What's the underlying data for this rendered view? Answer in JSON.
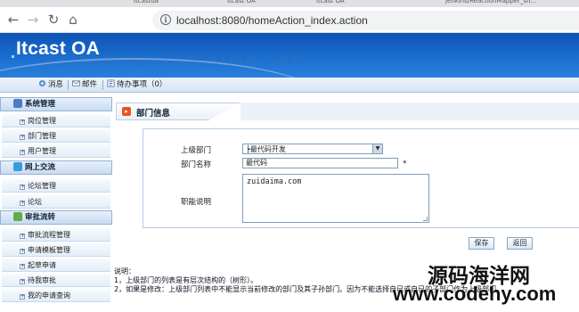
{
  "browser": {
    "tabs": [
      "",
      "Itcastoa",
      "Itcast OA",
      "itcast OA",
      "jenkins/ReactionMapper_sh..."
    ],
    "url": "localhost:8080/homeAction_index.action"
  },
  "app": {
    "logo": "Itcast OA",
    "toolbar": {
      "messages": "消息",
      "mail": "邮件",
      "todo": "待办事项（0）"
    }
  },
  "sidebar": {
    "groups": [
      {
        "label": "系统管理",
        "items": [
          "岗位管理",
          "部门管理",
          "用户管理"
        ]
      },
      {
        "label": "网上交流",
        "items": [
          "论坛管理",
          "论坛"
        ]
      },
      {
        "label": "审批流转",
        "items": [
          "审批流程管理",
          "申请模板管理",
          "起草申请",
          "待我审批",
          "我的申请查询"
        ]
      }
    ]
  },
  "main": {
    "title": "部门信息",
    "form": {
      "parent_label": "上级部门",
      "parent_value": "┝最代码开发",
      "name_label": "部门名称",
      "name_value": "最代码",
      "required_mark": "*",
      "desc_label": "职能说明",
      "desc_value": "zuidaima.com"
    },
    "buttons": {
      "save": "保存",
      "back": "返回"
    },
    "notes": {
      "heading": "说明：",
      "line1": "1，上级部门的列表是有层次结构的（树形）。",
      "line2": "2，如果是修改：上级部门列表中不能显示当前修改的部门及其子孙部门。因为不能选择自已或自已的子部门作为上级部门。"
    }
  },
  "watermarks": {
    "top": "weixunyan.zuidaima.com",
    "brand_cn": "源码海洋网",
    "brand_url": "www.codehy.com"
  },
  "colors": {
    "banner": "#1b6ecf",
    "accent_orange": "#e8541b"
  }
}
